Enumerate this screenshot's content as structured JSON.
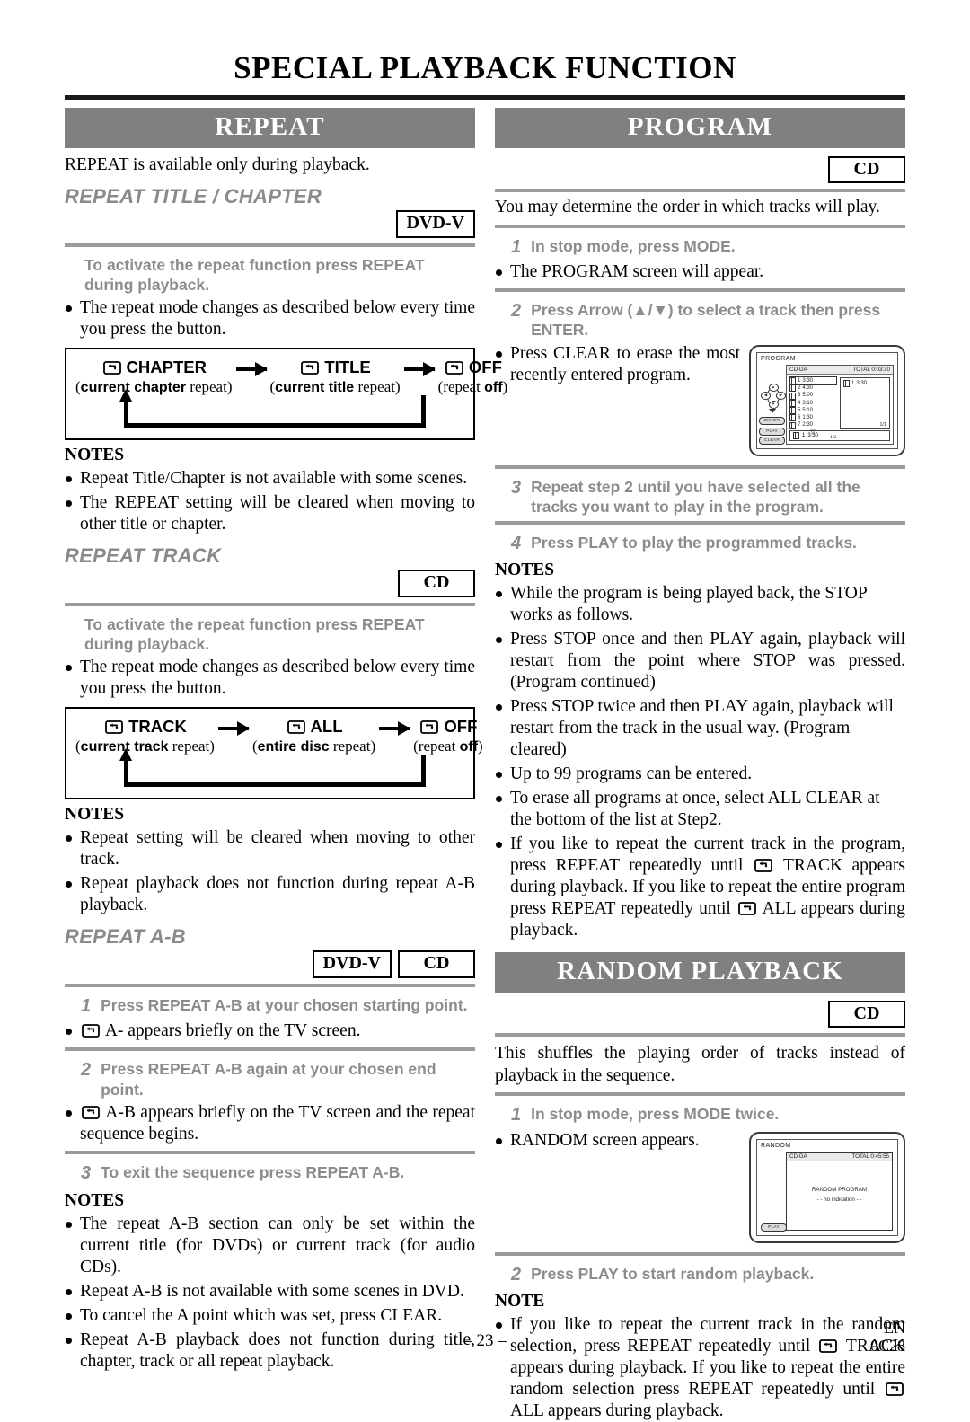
{
  "page": {
    "title": "SPECIAL PLAYBACK FUNCTION",
    "number": "– 23 –",
    "lang_code": "EN",
    "doc_code": "0C28"
  },
  "badges": {
    "dvd_v": "DVD-V",
    "cd": "CD"
  },
  "repeat": {
    "banner": "REPEAT",
    "intro": "REPEAT is available only during playback.",
    "title_chapter": {
      "heading": "REPEAT TITLE / CHAPTER",
      "badge": "DVD-V",
      "instruction": "To activate the repeat function press REPEAT during playback.",
      "bullet": "The repeat mode changes as described below every time you press the button.",
      "flow": [
        {
          "label": "CHAPTER",
          "sub_bold": "current chapter",
          "sub_rest": "repeat",
          "icon": "repeat-loop-icon"
        },
        {
          "label": "TITLE",
          "sub_bold": "current title",
          "sub_rest": "repeat",
          "icon": "repeat-loop-icon"
        },
        {
          "label": "OFF",
          "sub_bold": "off",
          "sub_rest": "repeat",
          "icon": "repeat-loop-icon"
        }
      ],
      "notes_heading": "NOTES",
      "notes": [
        "Repeat Title/Chapter is not available with some scenes.",
        "The REPEAT setting will be cleared when moving to other title or chapter."
      ]
    },
    "track": {
      "heading": "REPEAT TRACK",
      "badge": "CD",
      "instruction": "To activate the repeat function press REPEAT during playback.",
      "bullet": "The repeat mode changes as described below every time you press the button.",
      "flow": [
        {
          "label": "TRACK",
          "sub_bold": "current track",
          "sub_rest": "repeat",
          "icon": "repeat-loop-icon"
        },
        {
          "label": "ALL",
          "sub_bold": "entire disc",
          "sub_rest": "repeat",
          "icon": "repeat-loop-icon"
        },
        {
          "label": "OFF",
          "sub_bold": "off",
          "sub_rest": "repeat",
          "icon": "repeat-loop-icon"
        }
      ],
      "notes_heading": "NOTES",
      "notes": [
        "Repeat setting will be cleared when moving to other track.",
        "Repeat playback does not function during repeat A-B playback."
      ]
    },
    "ab": {
      "heading": "REPEAT A-B",
      "badges": [
        "DVD-V",
        "CD"
      ],
      "steps": [
        {
          "num": "1",
          "text": "Press REPEAT A-B at your chosen starting point."
        },
        {
          "num": "2",
          "text": "Press REPEAT A-B again at your chosen end point."
        },
        {
          "num": "3",
          "text": "To exit the sequence press REPEAT A-B."
        }
      ],
      "bullet1": "A- appears briefly on the TV screen.",
      "bullet2": "A-B appears briefly on the TV screen and the repeat sequence begins.",
      "notes_heading": "NOTES",
      "notes": [
        "The repeat A-B section can only be set within the current title (for DVDs) or current track (for audio CDs).",
        "Repeat A-B is not available with some scenes in DVD.",
        "To cancel the A point which was set, press CLEAR.",
        "Repeat A-B playback does not function during title, chapter, track or all repeat playback."
      ]
    }
  },
  "program": {
    "banner": "PROGRAM",
    "badge": "CD",
    "intro": "You may determine the order in which tracks will play.",
    "steps": [
      {
        "num": "1",
        "text": "In stop mode, press MODE."
      },
      {
        "num": "2",
        "text": "Press Arrow (▲/▼) to select a track then press ENTER."
      },
      {
        "num": "3",
        "text": "Repeat step 2 until you have selected all the tracks you want to play in the program."
      },
      {
        "num": "4",
        "text": "Press PLAY to play the programmed tracks."
      }
    ],
    "bullet_step1": "The PROGRAM screen will appear.",
    "bullet_step2": "Press CLEAR to erase the most recently entered program.",
    "osd": {
      "title": "PROGRAM",
      "disc_type": "CD-DA",
      "total_label": "TOTAL 0:03:30",
      "tracks": [
        {
          "no": "1",
          "time": "3:30"
        },
        {
          "no": "2",
          "time": "4:30"
        },
        {
          "no": "3",
          "time": "5:00"
        },
        {
          "no": "4",
          "time": "3:10"
        },
        {
          "no": "5",
          "time": "5:10"
        },
        {
          "no": "6",
          "time": "1:30"
        },
        {
          "no": "7",
          "time": "2:30"
        }
      ],
      "list_page": "1/2",
      "program_entries": [
        {
          "no": "1",
          "time": "3:30"
        }
      ],
      "program_page": "1/1",
      "selected_bottom": {
        "no": "1",
        "time": "3:30"
      },
      "buttons": [
        "ENTER",
        "PLAY",
        "CLEAR"
      ]
    },
    "notes_heading": "NOTES",
    "notes": [
      "While the program is being played back, the STOP works as follows.",
      "Press STOP once and then PLAY again, playback will restart from the point where STOP was pressed. (Program continued)",
      "Press STOP twice and then PLAY again, playback will restart from the track in the usual way. (Program cleared)",
      "Up to 99 programs can be entered.",
      "To erase all programs at once, select ALL CLEAR at the bottom of the list at Step2."
    ],
    "note_repeat_part1": "If you like to repeat the current track in the program, press REPEAT repeatedly until",
    "note_repeat_part2": "TRACK appears during playback. If you like to repeat the entire program press REPEAT repeatedly until",
    "note_repeat_part3": "ALL appears during playback."
  },
  "random": {
    "banner": "RANDOM PLAYBACK",
    "badge": "CD",
    "intro": "This shuffles the playing order of tracks instead of playback in the sequence.",
    "steps": [
      {
        "num": "1",
        "text": "In stop mode, press MODE twice."
      },
      {
        "num": "2",
        "text": "Press PLAY to start random playback."
      }
    ],
    "bullet_step1": "RANDOM screen appears.",
    "osd": {
      "title": "RANDOM",
      "disc_type": "CD-DA",
      "total_label": "TOTAL 0:45:55",
      "body_line1": "RANDOM PROGRAM",
      "body_line2": "- - no indication - -",
      "button": "PLAY"
    },
    "note_heading": "NOTE",
    "note_part1": "If you like to repeat the current track in the random selection, press REPEAT repeatedly until",
    "note_part2": "TRACK appears during playback. If you like to repeat the entire random selection press REPEAT repeatedly until",
    "note_part3": "ALL appears during playback."
  }
}
